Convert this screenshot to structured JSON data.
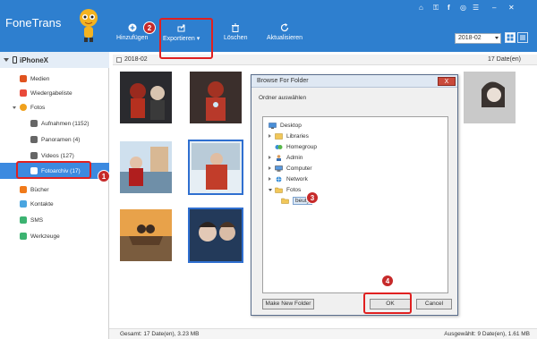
{
  "app": {
    "title": "FoneTrans"
  },
  "window_controls": [
    "cart-icon",
    "key-icon",
    "facebook-icon",
    "chat-icon",
    "menu-icon",
    "minimize-icon",
    "close-icon"
  ],
  "device": {
    "name": "iPhoneX"
  },
  "sidebar": {
    "items": [
      {
        "label": "Medien",
        "icon": "media-icon",
        "color": "#e0531f"
      },
      {
        "label": "Wiedergabeliste",
        "icon": "playlist-icon",
        "color": "#e94a3a"
      },
      {
        "label": "Fotos",
        "icon": "photos-icon",
        "color": "#f0a11c"
      },
      {
        "label": "Aufnahmen (1152)",
        "icon": "camera-icon",
        "color": "#555"
      },
      {
        "label": "Panoramen (4)",
        "icon": "panorama-icon",
        "color": "#555"
      },
      {
        "label": "Videos (127)",
        "icon": "video-icon",
        "color": "#555"
      },
      {
        "label": "Fotoarchiv (17)",
        "icon": "archive-icon",
        "color": "#fff"
      },
      {
        "label": "Bücher",
        "icon": "book-icon",
        "color": "#f07a1a"
      },
      {
        "label": "Kontakte",
        "icon": "contacts-icon",
        "color": "#4aa5e0"
      },
      {
        "label": "SMS",
        "icon": "sms-icon",
        "color": "#3cb371"
      },
      {
        "label": "Werkzeuge",
        "icon": "tools-icon",
        "color": "#3cb371"
      }
    ]
  },
  "toolbar": {
    "add": "Hinzufügen",
    "export": "Exportieren",
    "delete": "Löschen",
    "refresh": "Aktualisieren",
    "date_filter": "2018-02"
  },
  "content": {
    "date_group": "2018-02",
    "date_count": "17 Date(en)"
  },
  "status": {
    "total": "Gesamt: 17 Date(en), 3.23 MB",
    "selected": "Ausgewählt: 9 Date(en), 1.61 MB"
  },
  "dialog": {
    "title": "Browse For Folder",
    "close": "X",
    "instruction": "Ordner auswählen",
    "tree": [
      {
        "label": "Desktop",
        "level": 0,
        "icon": "desktop-icon"
      },
      {
        "label": "Libraries",
        "level": 1,
        "icon": "libraries-icon"
      },
      {
        "label": "Homegroup",
        "level": 1,
        "icon": "homegroup-icon"
      },
      {
        "label": "Admin",
        "level": 1,
        "icon": "user-icon"
      },
      {
        "label": "Computer",
        "level": 1,
        "icon": "computer-icon"
      },
      {
        "label": "Network",
        "level": 1,
        "icon": "network-icon"
      },
      {
        "label": "Fotos",
        "level": 1,
        "icon": "folder-icon"
      },
      {
        "label": "beuty",
        "level": 2,
        "icon": "folder-icon"
      }
    ],
    "make_folder": "Make New Folder",
    "ok": "OK",
    "cancel": "Cancel"
  },
  "annotations": [
    "1",
    "2",
    "3",
    "4"
  ],
  "colors": {
    "accent": "#2e7fcf",
    "selected": "#3c8ae0",
    "highlight": "#e02020",
    "badge": "#c62a2a"
  }
}
